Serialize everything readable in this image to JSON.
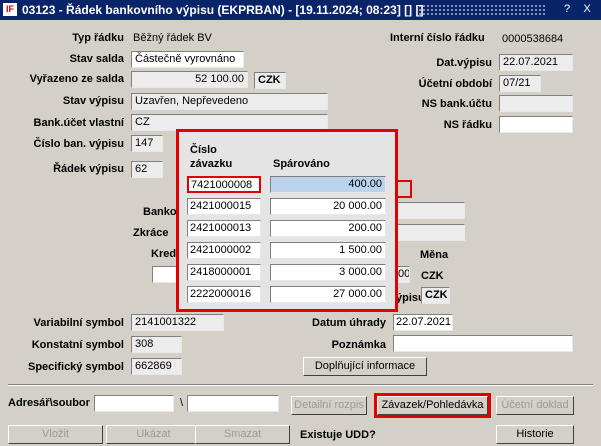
{
  "window": {
    "title": "03123 - Řádek bankovního výpisu (EKPRBAN) - [19.11.2024; 08:23] [] []",
    "logo": "IF",
    "buttons": [
      "?",
      "X"
    ]
  },
  "form": {
    "typ_radku": {
      "label": "Typ řádku",
      "value": "Běžný řádek BV"
    },
    "stav_salda": {
      "label": "Stav salda",
      "value": "Částečně vyrovnáno"
    },
    "vyrazeno": {
      "label": "Vyřazeno ze salda",
      "value": "52 100.00",
      "currency": "CZK"
    },
    "stav_vypisu": {
      "label": "Stav výpisu",
      "value": "Uzavřen, Nepřevedeno"
    },
    "bank_ucet": {
      "label": "Bank.účet vlastní",
      "value": "CZ"
    },
    "cislo_ban": {
      "label": "Číslo ban. výpisu",
      "value": "147"
    },
    "radek_vypisu": {
      "label": "Řádek výpisu",
      "value": "62"
    },
    "interni_cislo": {
      "label": "Interní číslo řádku",
      "value": "0000538684"
    },
    "dat_vypisu": {
      "label": "Dat.výpisu",
      "value": "22.07.2021"
    },
    "ucetni_obdobi": {
      "label": "Účetní období",
      "value": "07/21"
    },
    "ns_bank": {
      "label": "NS bank.účtu",
      "value": ""
    },
    "ns_radku": {
      "label": "NS řádku",
      "value": ""
    },
    "banko_partial": "Banko",
    "zkraceny_partial": "Zkráce",
    "kred_partial": "Kred",
    "mena": {
      "label": "Měna",
      "value": "CZK"
    },
    "mena_partial_value": "00",
    "vypisu_partial": "ýpisu",
    "vypisu_currency": "CZK",
    "variabilni": {
      "label": "Variabilní symbol",
      "value": "2141001322"
    },
    "konstantni": {
      "label": "Konstatní symbol",
      "value": "308"
    },
    "specificky": {
      "label": "Specifický symbol",
      "value": "662869"
    },
    "datum_uhrady": {
      "label": "Datum úhrady",
      "value": "22.07.2021"
    },
    "poznamka": {
      "label": "Poznámka",
      "value": ""
    },
    "doplnujici_btn": "Doplňující informace"
  },
  "popup": {
    "col1_header_line1": "Číslo",
    "col1_header_line2": "závazku",
    "col2_header": "Spárováno",
    "rows": [
      {
        "cislo": "7421000008",
        "sparovano": "400.00"
      },
      {
        "cislo": "2421000015",
        "sparovano": "20 000.00"
      },
      {
        "cislo": "2421000013",
        "sparovano": "200.00"
      },
      {
        "cislo": "2421000002",
        "sparovano": "1 500.00"
      },
      {
        "cislo": "2418000001",
        "sparovano": "3 000.00"
      },
      {
        "cislo": "2222000016",
        "sparovano": "27 000.00"
      }
    ]
  },
  "footer": {
    "adresar_label": "Adresář\\soubor",
    "backslash": "\\",
    "detailni_btn": "Detailní rozpis",
    "zavazek_btn": "Závazek/Pohledávka",
    "ucetni_doklad_btn": "Účetní doklad",
    "vlozit_btn": "Vložit",
    "ukazat_btn": "Ukázat",
    "smazat_btn": "Smazat",
    "existuje_label": "Existuje UDD?",
    "historie_btn": "Historie"
  }
}
